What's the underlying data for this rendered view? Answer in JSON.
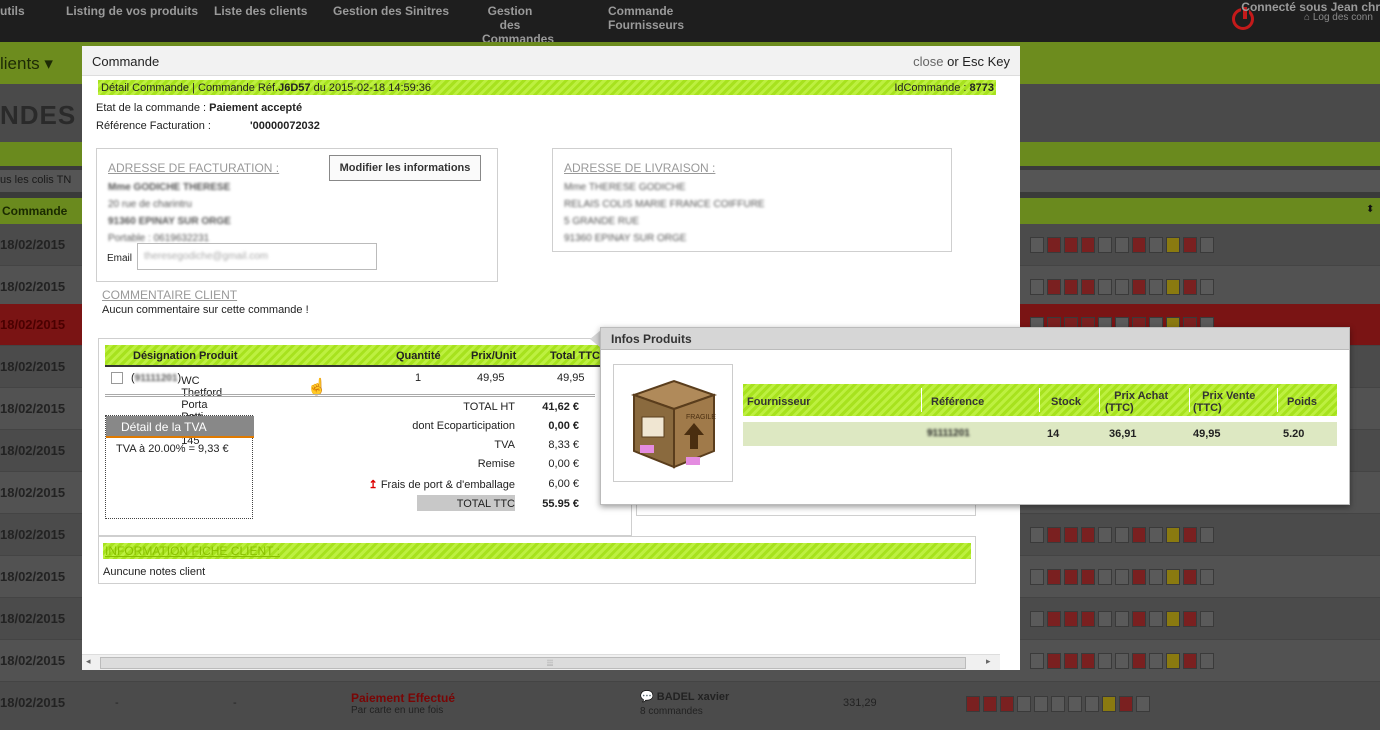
{
  "topnav": {
    "items": [
      "Listing de vos produits",
      "Liste des clients",
      "Gestion des Sinitres",
      "Gestion des\nCommandes",
      "Commande\nFournisseurs"
    ],
    "user": "Connecté sous Jean chr",
    "logout": "Log des conn"
  },
  "background": {
    "clients_label": "Clients",
    "page_title": "NDES",
    "filter_text": "us les colis TN",
    "col_commande": "Commande",
    "dates": [
      "18/02/2015",
      "18/02/2015",
      "18/02/2015",
      "18/02/2015",
      "18/02/2015",
      "18/02/2015",
      "18/02/2015",
      "18/02/2015",
      "18/02/2015",
      "18/02/2015",
      "18/02/2015"
    ],
    "last_row": {
      "date": "18/02/2015",
      "dash1": "-",
      "dash2": "-",
      "status": "Paiement Effectué",
      "status_sub": "Par carte en une fois",
      "client": "BADEL xavier",
      "client_orders": "8 commandes",
      "amount": "331,29"
    }
  },
  "modal": {
    "title": "Commande",
    "close": "close",
    "or_esc": "or Esc Key",
    "detail_prefix": "Détail Commande | Commande Réf.",
    "ref": "J6D57",
    "detail_date": " du 2015-02-18 14:59:36",
    "idcommande_label": "IdCommande : ",
    "idcommande": "8773",
    "etat_label": "Etat de la commande : ",
    "etat_value": "Paiement accepté",
    "ref_fact_label": "Référence Facturation :",
    "ref_fact_value": "'00000072032",
    "billing": {
      "title": "ADRESSE DE FACTURATION :",
      "modify_button": "Modifier les informations",
      "name": "Mme GODICHE THERESE",
      "street": "20 rue de charintru",
      "city": "91360 EPINAY SUR ORGE",
      "phone": "Portable : 0619632231",
      "email_label": "Email",
      "email_value": "theresegodiche@gmail.com"
    },
    "shipping": {
      "title": "ADRESSE DE LIVRAISON :",
      "name": "Mme THERESE GODICHE",
      "relay": "RELAIS COLIS MARIE FRANCE COIFFURE",
      "street": "5 GRANDE RUE",
      "city": "91360 EPINAY SUR ORGE"
    },
    "comment": {
      "title": "COMMENTAIRE CLIENT",
      "text": "Aucun commentaire sur cette commande !"
    },
    "products": {
      "headers": [
        "Désignation Produit",
        "Quantité",
        "Prix/Unit",
        "Total TTC"
      ],
      "rows": [
        {
          "ref": "91111201",
          "name": "WC Thetford Porta Potti Qube 145",
          "qty": "1",
          "unit": "49,95",
          "total": "49,95"
        }
      ]
    },
    "tva": {
      "title": "Détail de la TVA",
      "line": "TVA à 20.00% = 9,33 €"
    },
    "totals": [
      {
        "label": "TOTAL HT",
        "value": "41,62 €",
        "bold": true
      },
      {
        "label": "dont Ecoparticipation",
        "value": "0,00 €",
        "bold": true
      },
      {
        "label": "TVA",
        "value": "8,33 €",
        "bold": false
      },
      {
        "label": "Remise",
        "value": "0,00 €",
        "bold": false
      },
      {
        "label": "Frais de port & d'emballage",
        "value": "6,00 €",
        "bold": false
      },
      {
        "label": "TOTAL TTC",
        "value": "55.95 €",
        "bold": true
      }
    ],
    "client_info": {
      "title": "INFORMATION FICHE CLIENT :",
      "text": "Auncune notes client"
    }
  },
  "popup": {
    "title": "Infos Produits",
    "headers": [
      "Fournisseur",
      "Référence",
      "Stock",
      "Prix Achat\n(TTC)",
      "Prix Vente\n(TTC)",
      "Poids"
    ],
    "row": {
      "fournisseur": "",
      "reference": "91111201",
      "stock": "14",
      "prix_achat": "36,91",
      "prix_vente": "49,95",
      "poids": "5.20"
    },
    "image_label": "FRAGILE"
  },
  "colors": {
    "accent_green": "#a7e21e",
    "alert_red": "#c41a1a",
    "overlay": "#3a3a3a"
  }
}
